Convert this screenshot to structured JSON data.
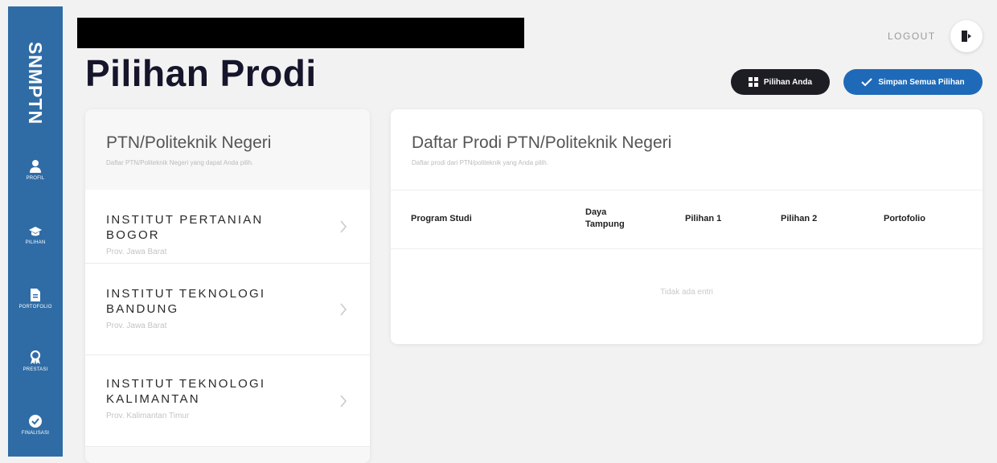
{
  "app": {
    "brand": "SNMPTN"
  },
  "sidebar": {
    "items": [
      {
        "label": "PROFIL",
        "icon": "user-icon"
      },
      {
        "label": "PILIHAN",
        "icon": "graduation-cap-icon"
      },
      {
        "label": "PORTOFOLIO",
        "icon": "document-icon"
      },
      {
        "label": "PRESTASI",
        "icon": "award-icon"
      },
      {
        "label": "FINALISASI",
        "icon": "check-circle-icon"
      }
    ]
  },
  "header": {
    "title": "Pilihan Prodi",
    "logout_label": "LOGOUT",
    "pilihan_anda_label": "Pilihan Anda",
    "simpan_label": "Simpan Semua Pilihan"
  },
  "left_panel": {
    "title": "PTN/Politeknik Negeri",
    "subtitle": "Daftar PTN/Politeknik Negeri yang dapat Anda pilih.",
    "items": [
      {
        "name": "INSTITUT PERTANIAN BOGOR",
        "province": "Prov. Jawa Barat"
      },
      {
        "name": "INSTITUT TEKNOLOGI BANDUNG",
        "province": "Prov. Jawa Barat"
      },
      {
        "name": "INSTITUT TEKNOLOGI KALIMANTAN",
        "province": "Prov. Kalimantan Timur"
      }
    ]
  },
  "right_panel": {
    "title": "Daftar Prodi PTN/Politeknik Negeri",
    "subtitle": "Daftar prodi dari PTN/politeknik yang Anda pilih.",
    "columns": [
      "Program Studi",
      "Daya Tampung",
      "Pilihan 1",
      "Pilihan 2",
      "Portofolio"
    ],
    "empty_text": "Tidak ada entri"
  },
  "colors": {
    "sidebar": "#2f6ca6",
    "primary_button": "#1f6ab8",
    "dark_button": "#1d1d24",
    "background": "#f2f2f2"
  }
}
